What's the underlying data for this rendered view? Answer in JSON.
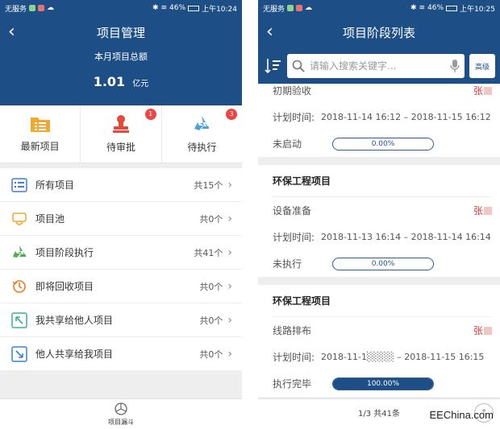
{
  "left": {
    "status": {
      "carrier": "无服务",
      "battery": "46%",
      "time": "上午10:24"
    },
    "title": "项目管理",
    "total_label": "本月项目总额",
    "total_value": "1.01",
    "total_unit": "亿元",
    "tiles": [
      {
        "label": "最新项目",
        "icon": "folder-list-icon",
        "badge": ""
      },
      {
        "label": "待审批",
        "icon": "stamp-icon",
        "badge": "1"
      },
      {
        "label": "待执行",
        "icon": "recycle-icon",
        "badge": "3"
      }
    ],
    "menu": [
      {
        "label": "所有项目",
        "count": "共15个",
        "icon": "list-icon"
      },
      {
        "label": "项目池",
        "count": "共0个",
        "icon": "pool-icon"
      },
      {
        "label": "项目阶段执行",
        "count": "共41个",
        "icon": "recycle-icon"
      },
      {
        "label": "即将回收项目",
        "count": "共0个",
        "icon": "clock-recycle-icon"
      },
      {
        "label": "我共享给他人项目",
        "count": "共0个",
        "icon": "share-out-icon"
      },
      {
        "label": "他人共享给我项目",
        "count": "共0个",
        "icon": "share-in-icon"
      }
    ],
    "bottom_tab": "项目漏斗"
  },
  "right": {
    "status": {
      "carrier": "无服务",
      "battery": "46%",
      "time": "上午10:25"
    },
    "title": "项目阶段列表",
    "search_placeholder": "请输入搜索关键字...",
    "advanced_label": "高级",
    "plan_label": "计划时间:",
    "cards": [
      {
        "title": "",
        "stage": "初期验收",
        "owner": "张",
        "plan": "2018-11-14 16:12 – 2018-11-15 16:12",
        "status": "未启动",
        "progress_text": "0.00%",
        "progress": 0
      },
      {
        "title": "环保工程项目",
        "stage": "设备准备",
        "owner": "张",
        "plan": "2018-11-13 16:14 – 2018-11-14 16:14",
        "status": "未执行",
        "progress_text": "0.00%",
        "progress": 0
      },
      {
        "title": "环保工程项目",
        "stage": "线路排布",
        "owner": "张",
        "plan": "2018-11-1░░░░ – 2018-11-15 16:15",
        "status": "执行完毕",
        "progress_text": "100.00%",
        "progress": 1
      }
    ],
    "pagination": "1/3 共41条"
  },
  "watermark": "EEChina.com",
  "colors": {
    "primary": "#1d4f86",
    "badge": "#ee4444",
    "owner": "#d93a3a"
  }
}
